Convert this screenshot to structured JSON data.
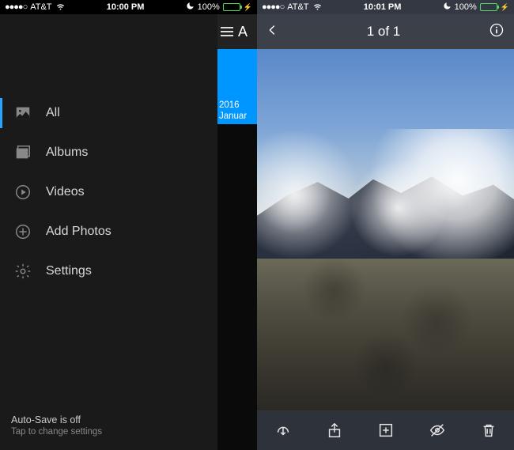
{
  "left": {
    "status": {
      "carrier": "AT&T",
      "time": "10:00 PM",
      "battery": "100%"
    },
    "peek": {
      "title_letter": "A",
      "year": "2016",
      "month": "Januar"
    },
    "menu": {
      "all": "All",
      "albums": "Albums",
      "videos": "Videos",
      "add_photos": "Add Photos",
      "settings": "Settings"
    },
    "footer": {
      "line1": "Auto-Save is off",
      "line2": "Tap to change settings"
    }
  },
  "right": {
    "status": {
      "carrier": "AT&T",
      "time": "10:01 PM",
      "battery": "100%"
    },
    "header": {
      "title": "1 of 1"
    }
  }
}
